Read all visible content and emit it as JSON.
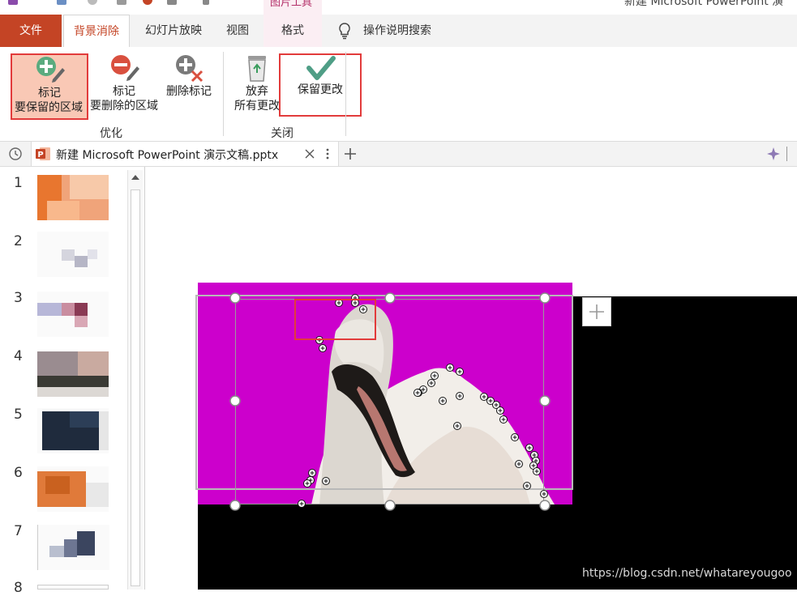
{
  "window": {
    "title_fragment": "新建 Microsoft PowerPoint 演",
    "contextual_group": "图片工具"
  },
  "tabs": {
    "file": "文件",
    "background_removal": "背景消除",
    "slideshow": "幻灯片放映",
    "view": "视图",
    "format": "格式",
    "search": "操作说明搜索"
  },
  "ribbon": {
    "mark_keep": {
      "line1": "标记",
      "line2": "要保留的区域"
    },
    "mark_remove": {
      "line1": "标记",
      "line2": "要删除的区域"
    },
    "delete_mark": "删除标记",
    "discard": {
      "line1": "放弃",
      "line2": "所有更改"
    },
    "keep_changes": "保留更改",
    "group_refine": "优化",
    "group_close": "关闭"
  },
  "doc_tab": {
    "name": "新建 Microsoft PowerPoint 演示文稿.pptx"
  },
  "slides": {
    "numbers": [
      "1",
      "2",
      "3",
      "4",
      "5",
      "6",
      "7",
      "8"
    ]
  },
  "watermark": "https://blog.csdn.net/whatareyougoo",
  "colors": {
    "accent": "#c44425",
    "removal_overlay": "#cc00cc",
    "highlight_box": "#e23b3b",
    "keep_button_bg": "#f9c8b5"
  },
  "icons": {
    "mark_keep": "green-plus-pencil-icon",
    "mark_remove": "red-minus-pencil-icon",
    "delete_mark": "gray-x-pencil-icon",
    "discard": "recycle-bin-icon",
    "keep_changes": "green-checkmark-icon",
    "search": "lightbulb-icon",
    "doc": "powerpoint-file-icon"
  }
}
